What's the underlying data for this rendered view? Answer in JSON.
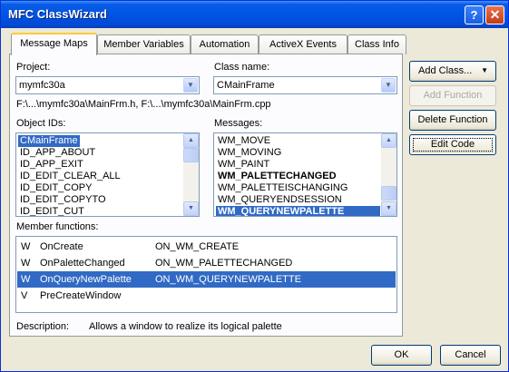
{
  "window": {
    "title": "MFC ClassWizard"
  },
  "titlebar": {
    "help_glyph": "?",
    "close_glyph": "✕"
  },
  "tabs": [
    {
      "label": "Message Maps",
      "active": true
    },
    {
      "label": "Member Variables",
      "active": false
    },
    {
      "label": "Automation",
      "active": false
    },
    {
      "label": "ActiveX Events",
      "active": false
    },
    {
      "label": "Class Info",
      "active": false
    }
  ],
  "project": {
    "label": "Project:",
    "value": "mymfc30a"
  },
  "class_name": {
    "label": "Class name:",
    "value": "CMainFrame"
  },
  "file_paths": "F:\\...\\mymfc30a\\MainFrm.h, F:\\...\\mymfc30a\\MainFrm.cpp",
  "object_ids": {
    "label": "Object IDs:",
    "items": [
      "CMainFrame",
      "ID_APP_ABOUT",
      "ID_APP_EXIT",
      "ID_EDIT_CLEAR_ALL",
      "ID_EDIT_COPY",
      "ID_EDIT_COPYTO",
      "ID_EDIT_CUT"
    ],
    "selected": "CMainFrame"
  },
  "messages": {
    "label": "Messages:",
    "items": [
      {
        "text": "WM_MOVE",
        "bold": false
      },
      {
        "text": "WM_MOVING",
        "bold": false
      },
      {
        "text": "WM_PAINT",
        "bold": false
      },
      {
        "text": "WM_PALETTECHANGED",
        "bold": true
      },
      {
        "text": "WM_PALETTEISCHANGING",
        "bold": false
      },
      {
        "text": "WM_QUERYENDSESSION",
        "bold": false
      },
      {
        "text": "WM_QUERYNEWPALETTE",
        "bold": true
      }
    ],
    "selected": "WM_QUERYNEWPALETTE"
  },
  "member_functions": {
    "label": "Member functions:",
    "rows": [
      {
        "type": "W",
        "name": "OnCreate",
        "macro": "ON_WM_CREATE"
      },
      {
        "type": "W",
        "name": "OnPaletteChanged",
        "macro": "ON_WM_PALETTECHANGED"
      },
      {
        "type": "W",
        "name": "OnQueryNewPalette",
        "macro": "ON_WM_QUERYNEWPALETTE"
      },
      {
        "type": "V",
        "name": "PreCreateWindow",
        "macro": ""
      }
    ],
    "selected": "OnQueryNewPalette"
  },
  "description": {
    "label": "Description:",
    "text": "Allows a window to realize its logical palette"
  },
  "buttons": {
    "add_class": "Add Class...",
    "add_function": "Add Function",
    "delete_function": "Delete Function",
    "edit_code": "Edit Code",
    "ok": "OK",
    "cancel": "Cancel"
  },
  "colors": {
    "titlebar": "#0055e5",
    "selection": "#316ac5",
    "dialog_bg": "#ece9d8"
  }
}
